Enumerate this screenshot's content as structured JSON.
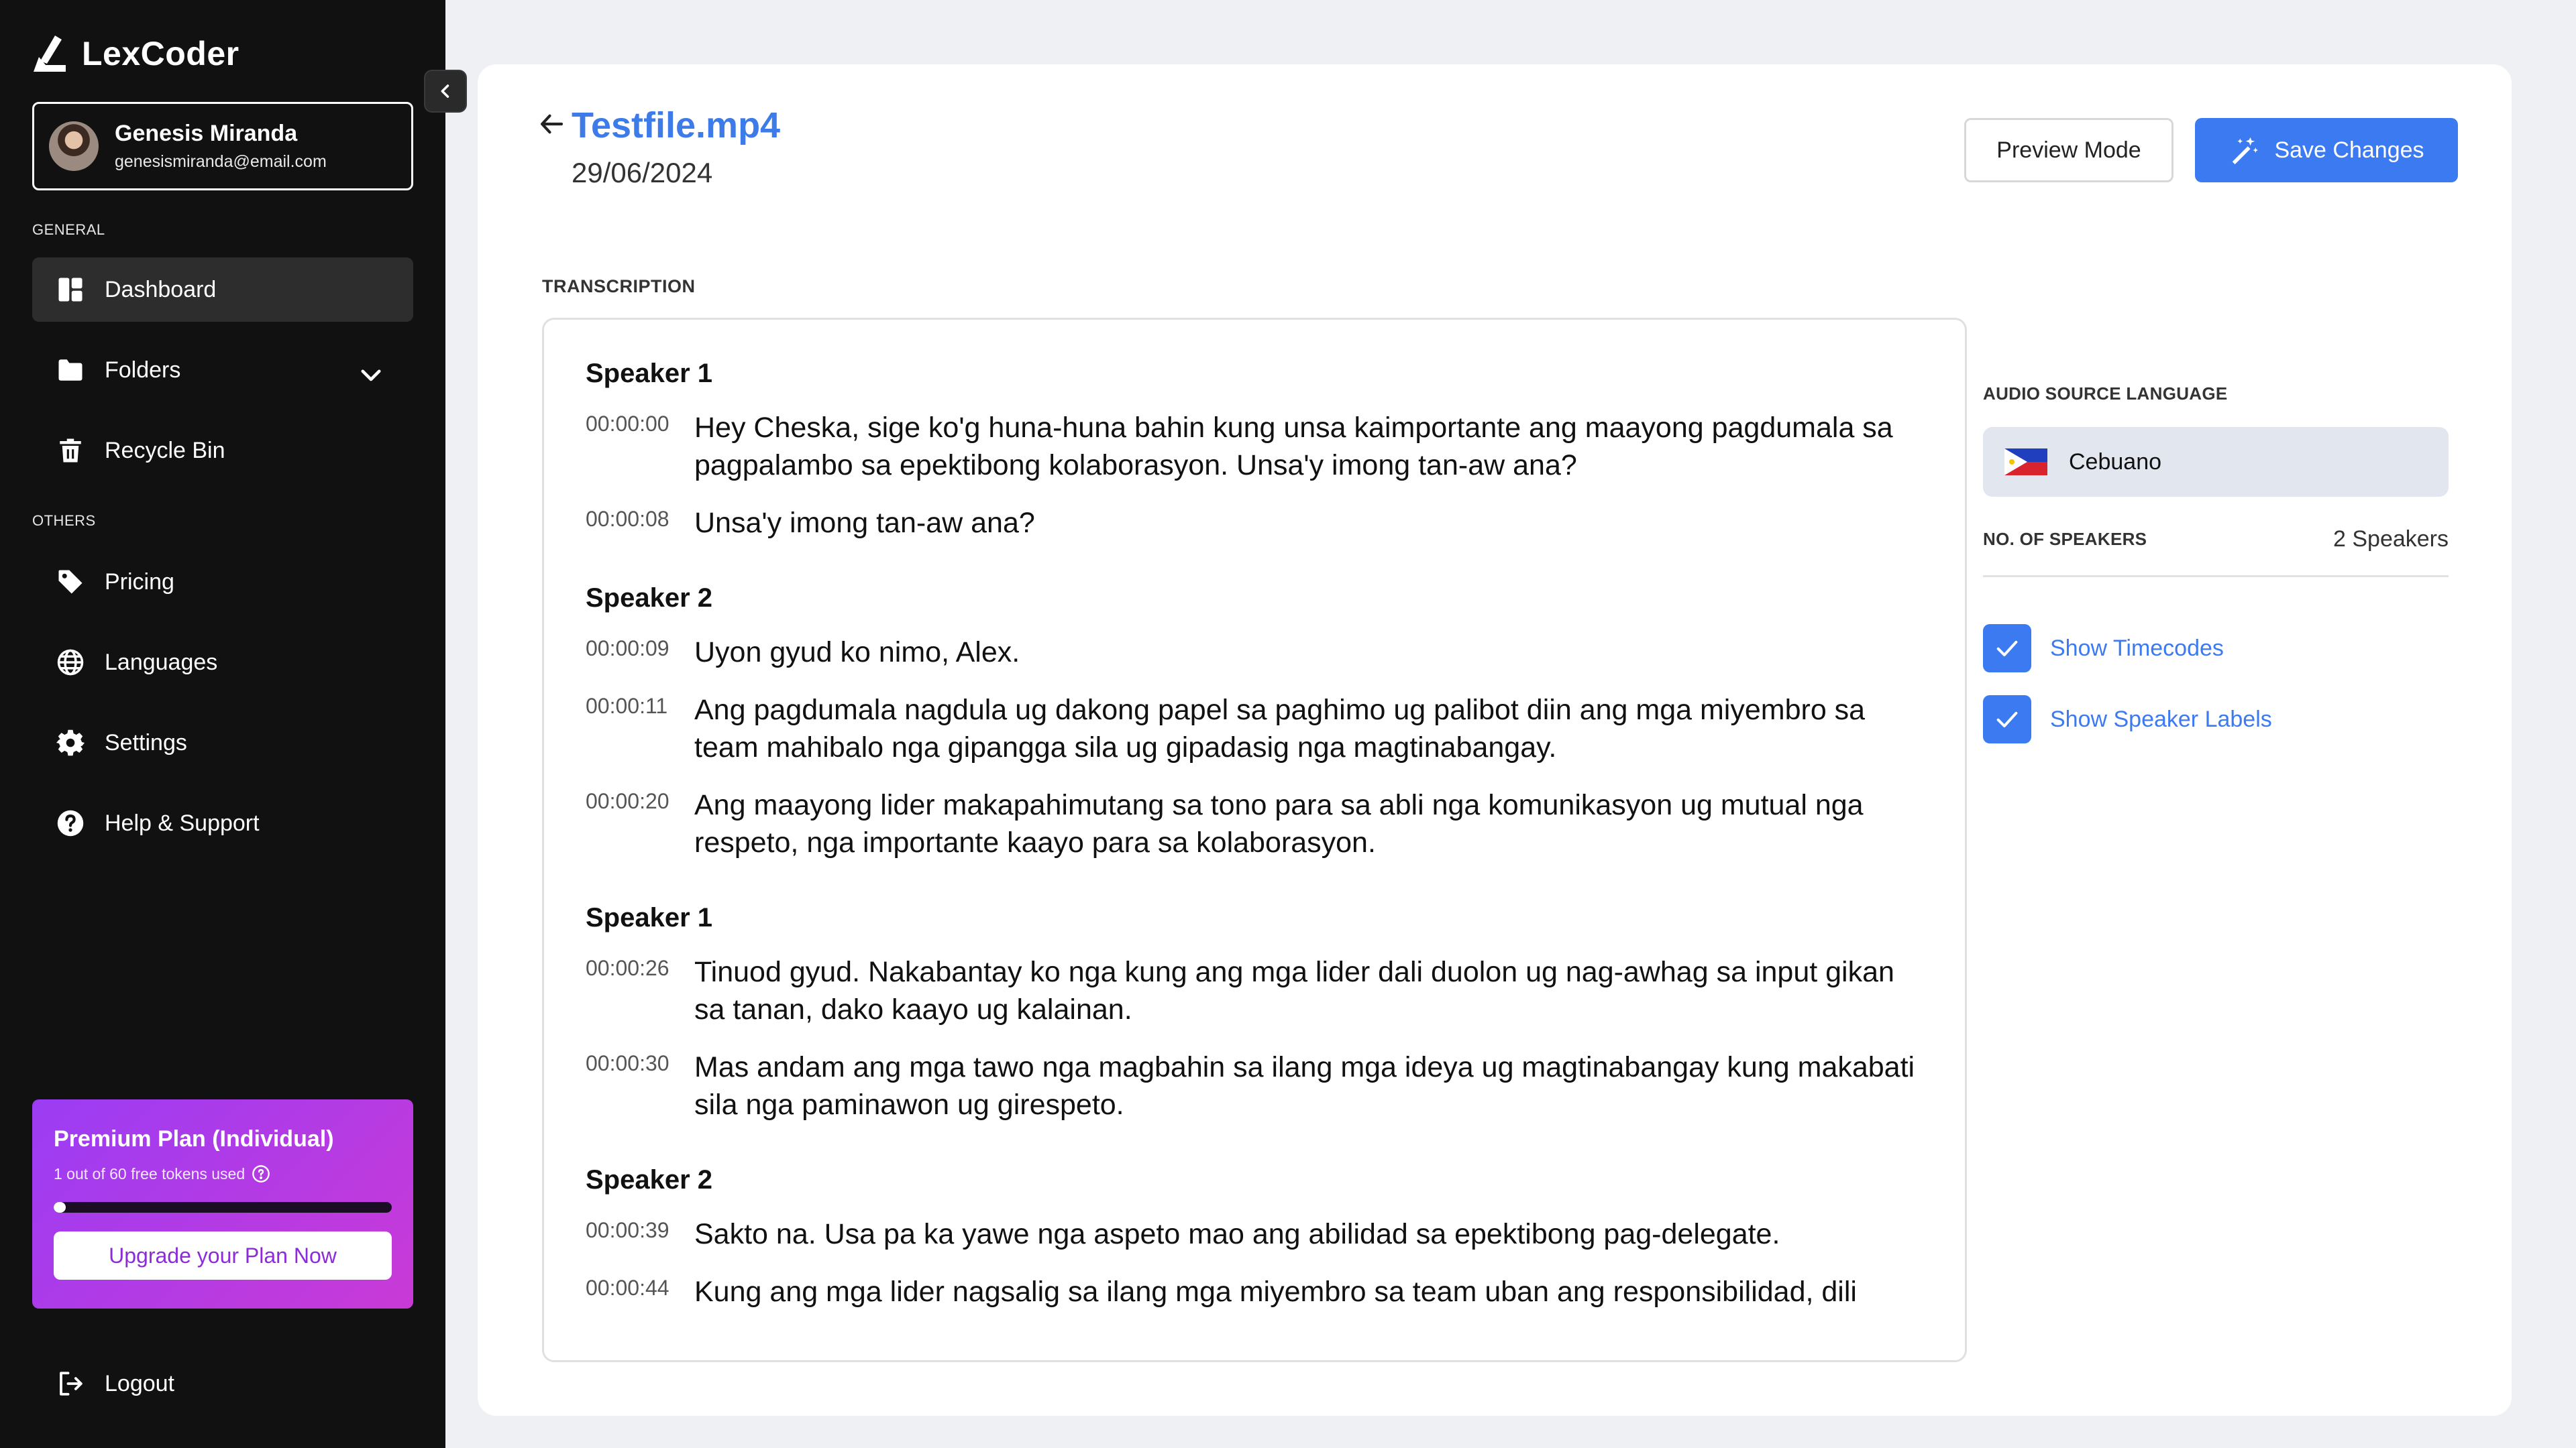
{
  "app": {
    "name": "LexCoder"
  },
  "user": {
    "name": "Genesis Miranda",
    "email": "genesismiranda@email.com"
  },
  "sidebar": {
    "general_label": "GENERAL",
    "others_label": "OTHERS",
    "items": [
      {
        "label": "Dashboard",
        "icon": "dashboard-icon"
      },
      {
        "label": "Folders",
        "icon": "folder-icon"
      },
      {
        "label": "Recycle Bin",
        "icon": "trash-icon"
      },
      {
        "label": "Pricing",
        "icon": "tag-icon"
      },
      {
        "label": "Languages",
        "icon": "globe-icon"
      },
      {
        "label": "Settings",
        "icon": "gear-icon"
      },
      {
        "label": "Help & Support",
        "icon": "help-icon"
      }
    ],
    "logout_label": "Logout"
  },
  "premium": {
    "title": "Premium Plan (Individual)",
    "tokens_text": "1 out of 60 free tokens used",
    "tokens_used": 1,
    "tokens_total": 60,
    "upgrade_label": "Upgrade your Plan Now"
  },
  "file": {
    "title": "Testfile.mp4",
    "date": "29/06/2024"
  },
  "toolbar": {
    "preview_label": "Preview Mode",
    "save_label": "Save Changes"
  },
  "transcription": {
    "label": "TRANSCRIPTION",
    "blocks": [
      {
        "speaker": "Speaker 1",
        "lines": [
          {
            "time": "00:00:00",
            "text": "Hey Cheska, sige ko'g huna-huna bahin kung unsa kaimportante ang maayong pagdumala sa pagpalambo sa epektibong kolaborasyon. Unsa'y imong tan-aw ana?"
          },
          {
            "time": "00:00:08",
            "text": "Unsa'y imong tan-aw ana?"
          }
        ]
      },
      {
        "speaker": "Speaker 2",
        "lines": [
          {
            "time": "00:00:09",
            "text": "Uyon gyud ko nimo, Alex."
          },
          {
            "time": "00:00:11",
            "text": "Ang pagdumala nagdula ug dakong papel sa paghimo ug palibot diin ang mga miyembro sa team mahibalo nga gipangga sila ug gipadasig nga magtinabangay."
          },
          {
            "time": "00:00:20",
            "text": "Ang maayong lider makapahimutang sa tono para sa abli nga komunikasyon ug mutual nga respeto, nga importante kaayo para sa kolaborasyon."
          }
        ]
      },
      {
        "speaker": "Speaker 1",
        "lines": [
          {
            "time": "00:00:26",
            "text": "Tinuod gyud. Nakabantay ko nga kung ang mga lider dali duolon ug nag-awhag sa input gikan sa tanan, dako kaayo ug kalainan."
          },
          {
            "time": "00:00:30",
            "text": "Mas andam ang mga tawo nga magbahin sa ilang mga ideya ug magtinabangay kung makabati sila nga paminawon ug girespeto."
          }
        ]
      },
      {
        "speaker": "Speaker 2",
        "lines": [
          {
            "time": "00:00:39",
            "text": "Sakto na. Usa pa ka yawe nga aspeto mao ang abilidad sa epektibong pag-delegate."
          },
          {
            "time": "00:00:44",
            "text": "Kung ang mga lider nagsalig sa ilang mga miyembro sa team uban ang responsibilidad, dili"
          }
        ]
      }
    ]
  },
  "settings_panel": {
    "audio_label": "AUDIO SOURCE LANGUAGE",
    "language": "Cebuano",
    "speakers_label": "NO. OF SPEAKERS",
    "speakers_value": "2 Speakers",
    "show_timecodes": "Show Timecodes",
    "show_speaker_labels": "Show Speaker Labels"
  },
  "colors": {
    "accent": "#3b7af1",
    "sidebar": "#111111",
    "premium_start": "#9b3cf4",
    "premium_end": "#c93ad6"
  }
}
